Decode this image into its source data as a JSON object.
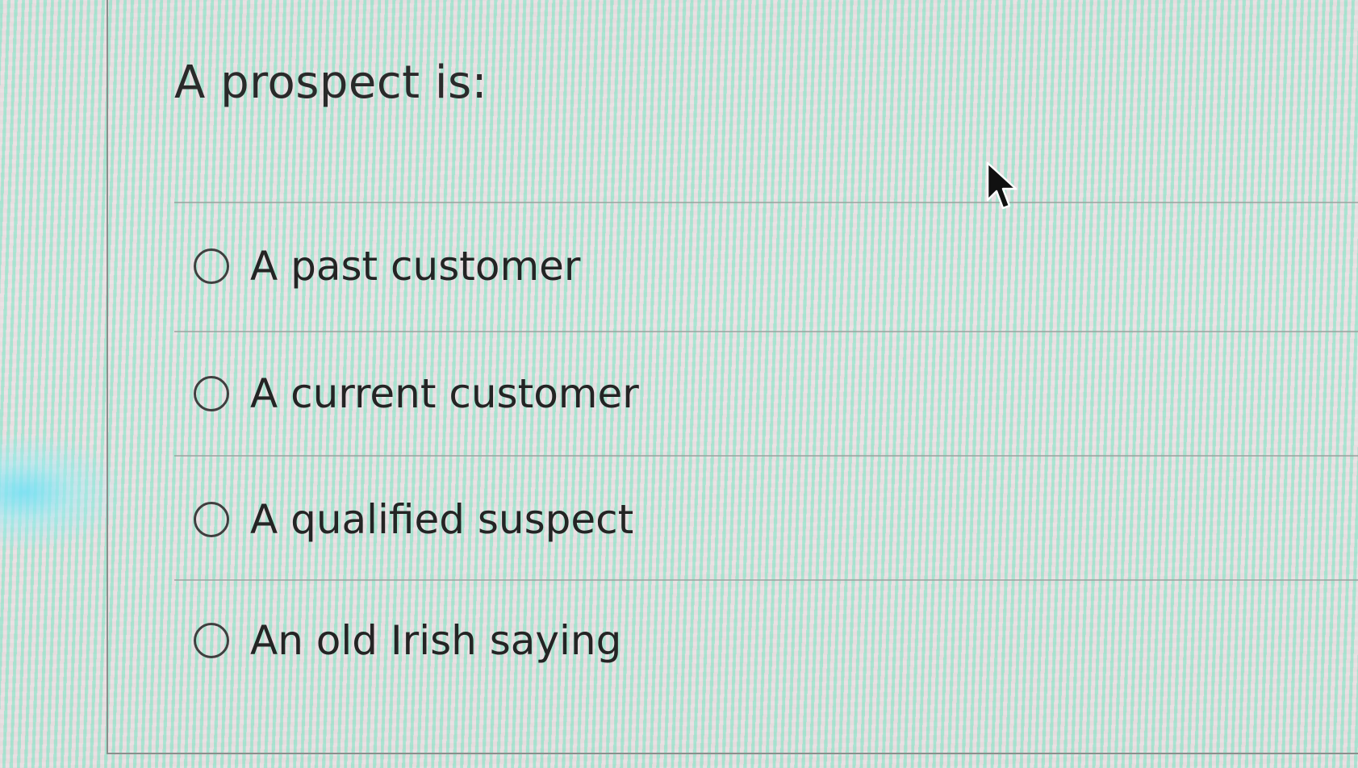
{
  "question": {
    "text": "A prospect is:"
  },
  "options": [
    {
      "label": "A past customer",
      "selected": false
    },
    {
      "label": "A current customer",
      "selected": false
    },
    {
      "label": "A qualified suspect",
      "selected": false
    },
    {
      "label": "An old Irish saying",
      "selected": false
    }
  ],
  "cursor": {
    "icon": "mouse-pointer-icon"
  }
}
